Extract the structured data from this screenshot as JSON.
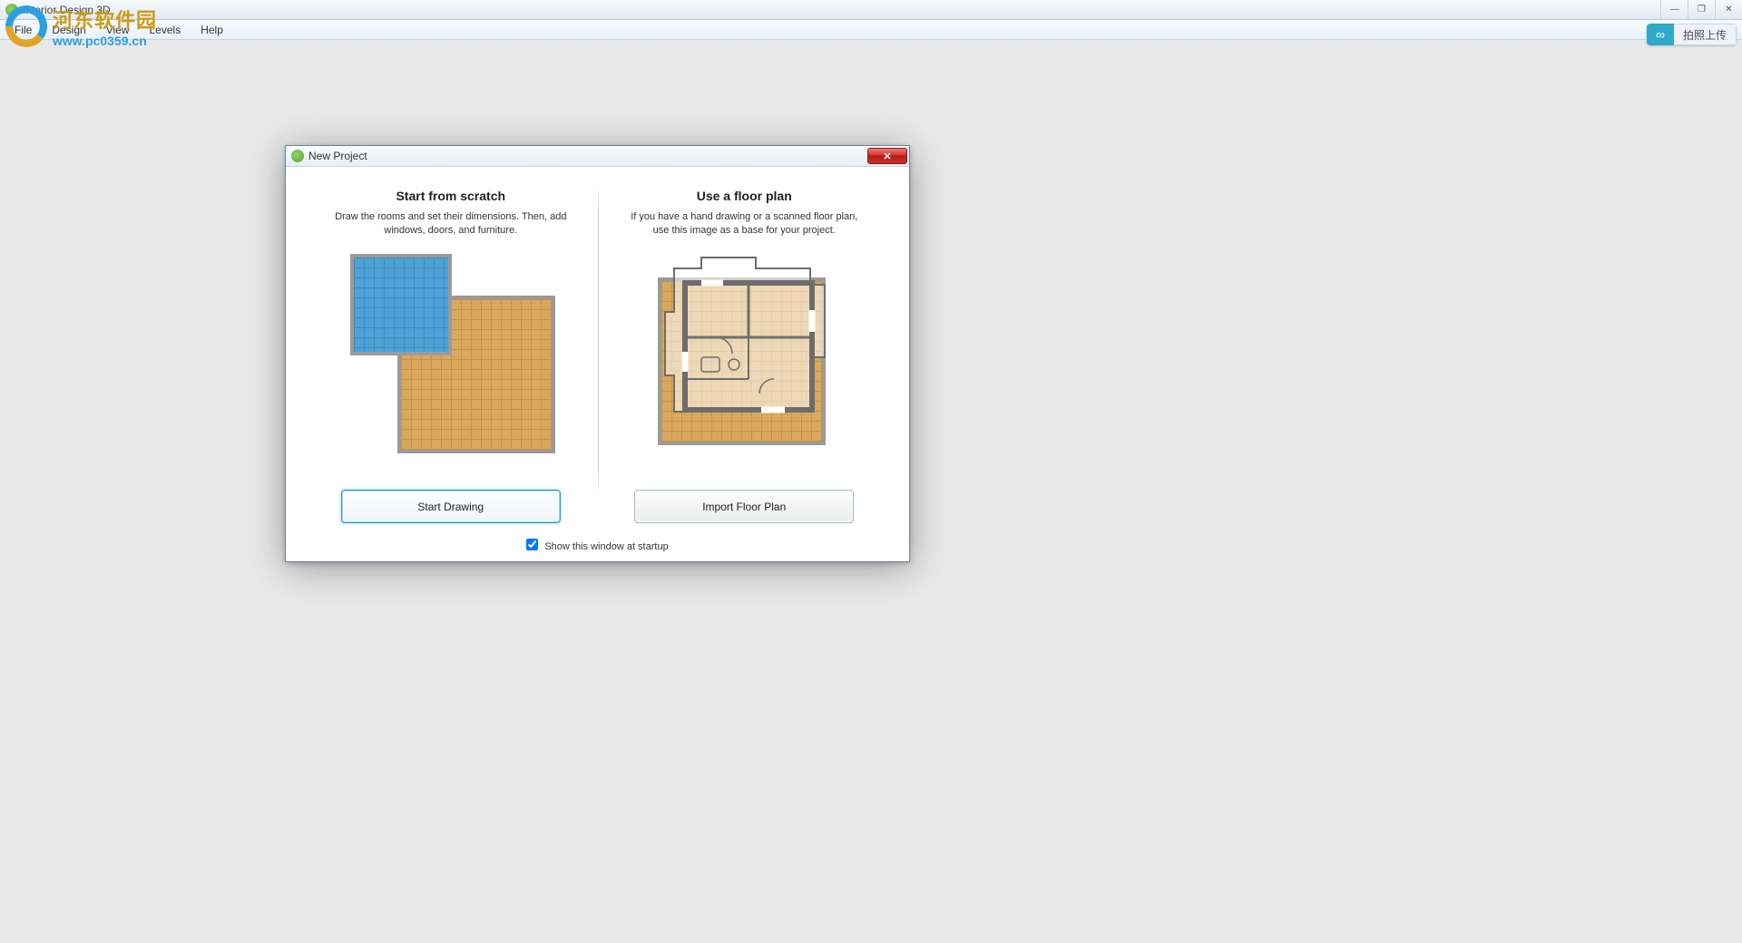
{
  "app": {
    "title": "Interior Design 3D",
    "window_controls": {
      "min": "—",
      "max": "❐",
      "close": "✕"
    }
  },
  "menubar": {
    "file": "File",
    "design": "Design",
    "view": "View",
    "levels": "Levels",
    "help": "Help"
  },
  "watermark": {
    "cn": "河东软件园",
    "url": "www.pc0359.cn"
  },
  "upload_badge": {
    "icon": "∞",
    "label": "拍照上传"
  },
  "dialog": {
    "title": "New Project",
    "close": "✕",
    "left": {
      "heading": "Start from scratch",
      "desc": "Draw the rooms and set their dimensions. Then, add windows, doors, and furniture.",
      "button": "Start Drawing"
    },
    "right": {
      "heading": "Use a floor plan",
      "desc": "If you have a hand drawing or a scanned floor plan, use this image as a base for your project.",
      "button": "Import Floor Plan"
    },
    "footer": {
      "show_at_startup": "Show this window at startup",
      "checked": true
    }
  }
}
